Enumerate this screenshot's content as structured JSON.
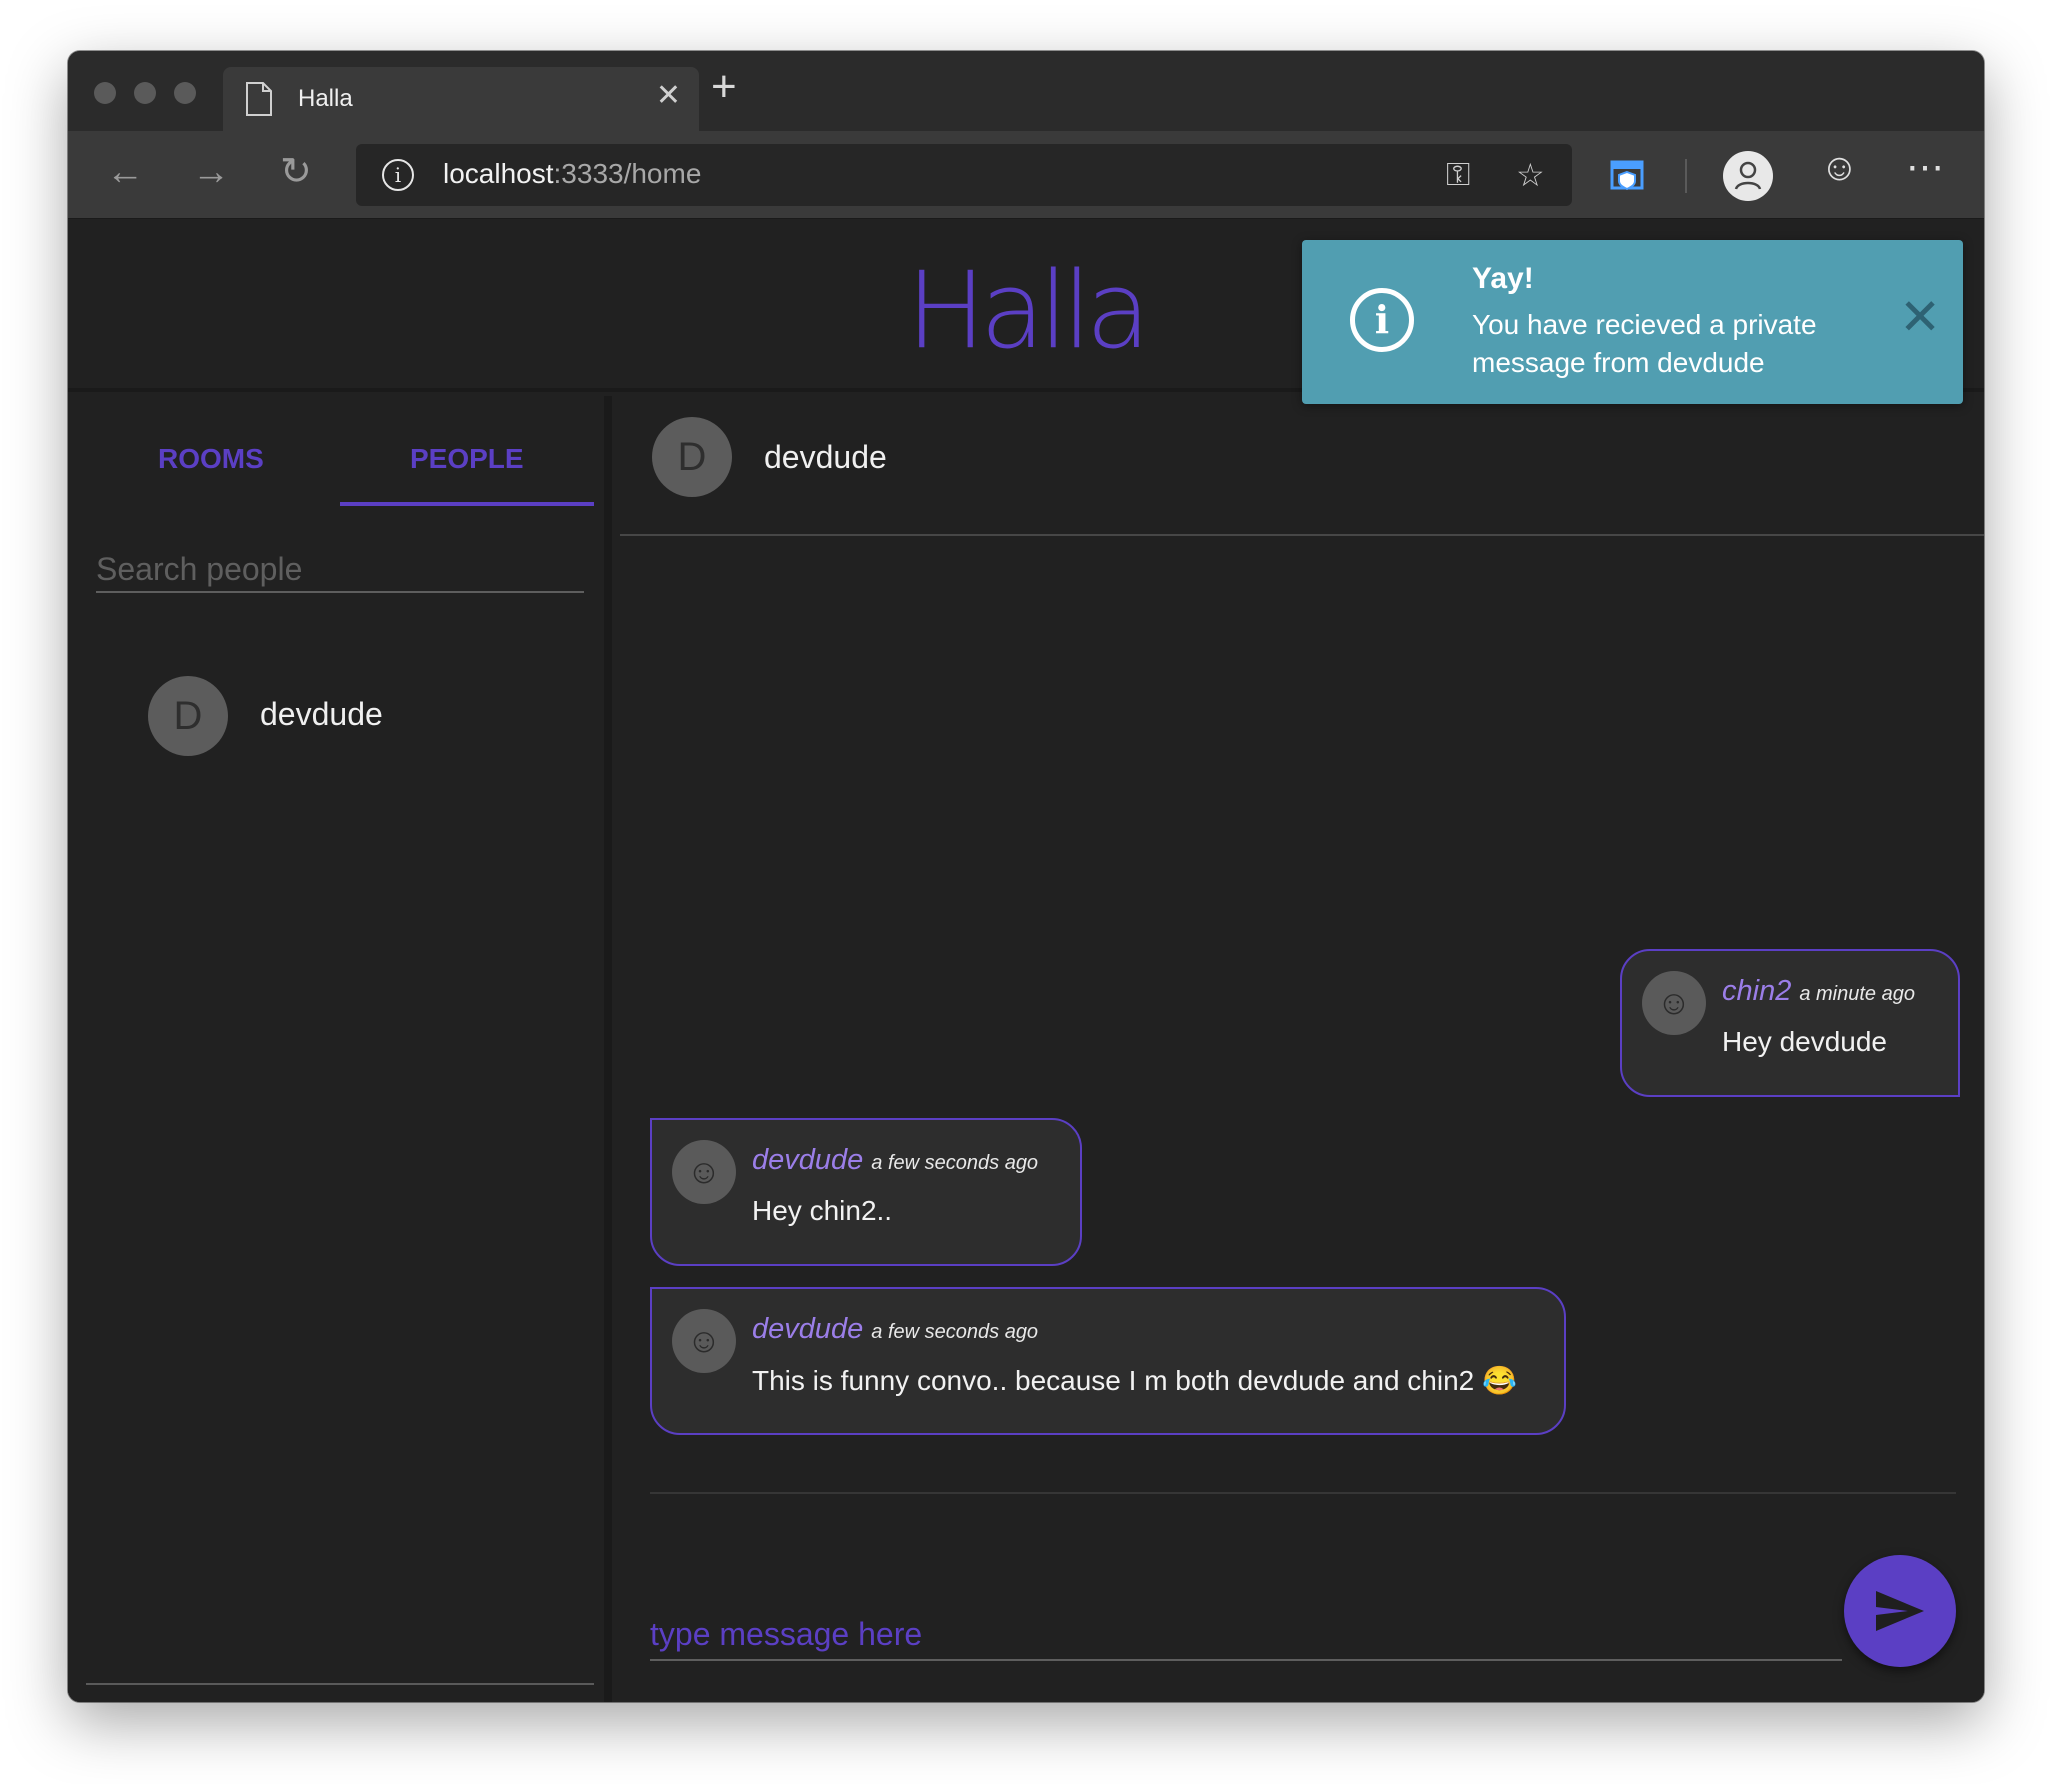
{
  "browser": {
    "tab_title": "Halla",
    "url_host": "localhost",
    "url_path": ":3333/home"
  },
  "app": {
    "title": "Halla"
  },
  "toast": {
    "title": "Yay!",
    "message": "You have recieved a private message from devdude",
    "color": "#519eb1"
  },
  "sidebar": {
    "tabs": [
      {
        "label": "ROOMS",
        "active": false
      },
      {
        "label": "PEOPLE",
        "active": true
      }
    ],
    "search_placeholder": "Search people",
    "people": [
      {
        "initial": "D",
        "name": "devdude"
      }
    ]
  },
  "chat": {
    "header": {
      "initial": "D",
      "name": "devdude"
    },
    "messages": [
      {
        "author": "chin2",
        "time": "a minute ago",
        "text": "Hey devdude",
        "side": "right"
      },
      {
        "author": "devdude",
        "time": "a few seconds ago",
        "text": "Hey chin2..",
        "side": "left"
      },
      {
        "author": "devdude",
        "time": "a few seconds ago",
        "text": "This is funny convo.. because I m both devdude and chin2 😂",
        "side": "left"
      }
    ],
    "compose_placeholder": "type message here"
  },
  "theme": {
    "accent": "#5b3fc4",
    "background": "#212121"
  }
}
